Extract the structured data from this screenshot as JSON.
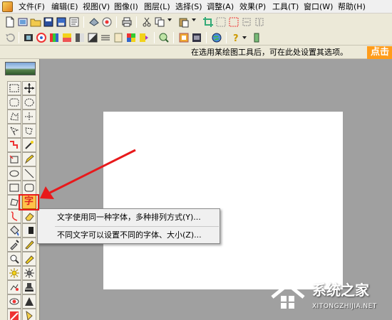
{
  "menubar": {
    "items": [
      "文件(F)",
      "编辑(E)",
      "视图(V)",
      "图像(I)",
      "图层(L)",
      "选择(S)",
      "调整(A)",
      "效果(P)",
      "工具(T)",
      "窗口(W)",
      "帮助(H)"
    ]
  },
  "hint_bar": {
    "text": "在选用某绘图工具后，可在此处设置其选项。",
    "badge": "点击"
  },
  "text_tool": {
    "glyph": "字"
  },
  "popup_menu": {
    "items": [
      "文字使用同一种字体，多种排列方式(Y)...",
      "不同文字可以设置不同的字体、大小(Z)..."
    ]
  },
  "watermark": {
    "title": "系统之家",
    "url": "XITONGZHIJIA.NET"
  },
  "colors": {
    "workspace": "#a0a0a0",
    "toolbar": "#ece9d8",
    "annotation_red": "#e8191b",
    "badge_orange": "#ff9c1a"
  },
  "icons": [
    "new-file-icon",
    "open-folder-icon",
    "save-icon",
    "print-icon",
    "cut-icon",
    "copy-icon",
    "paste-icon",
    "undo-icon",
    "color-palette-icon",
    "help-icon",
    "text-tool-icon",
    "move-tool-icon",
    "selection-tool-icon"
  ]
}
